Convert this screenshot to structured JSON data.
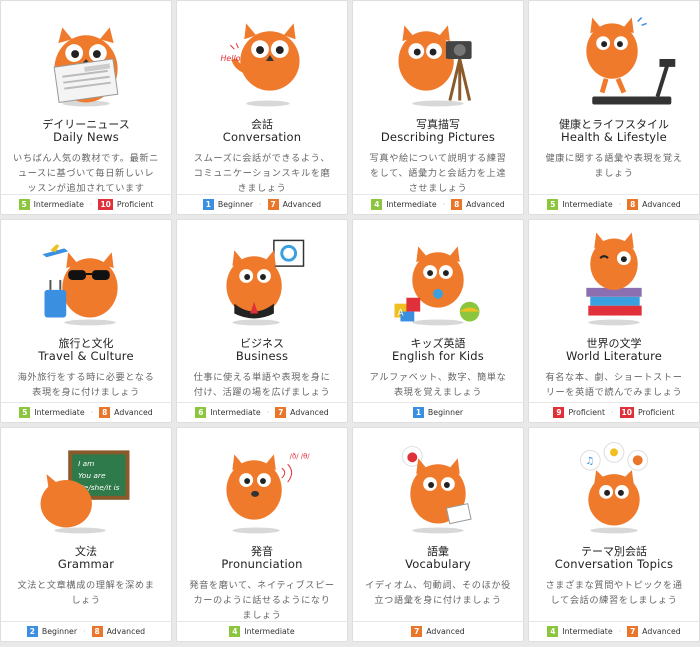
{
  "colors": {
    "orange": "#f07a2c",
    "beginner": "#3a8fe0",
    "intermediate": "#8cc63f",
    "advanced": "#e8762b",
    "proficient": "#e0313a"
  },
  "cards": [
    {
      "title_ja": "デイリーニュース",
      "title_en": "Daily News",
      "desc": "いちばん人気の教材です。最新ニュースに基づいて毎日新しいレッスンが追加されています",
      "icon": "owl-newspaper-icon",
      "levels": [
        {
          "num": "5",
          "label": "Intermediate",
          "color": "#8cc63f"
        },
        {
          "num": "10",
          "label": "Proficient",
          "color": "#e0313a"
        }
      ]
    },
    {
      "title_ja": "会話",
      "title_en": "Conversation",
      "desc": "スムーズに会話ができるよう、コミュニケーションスキルを磨きましょう",
      "icon": "owl-hello-icon",
      "levels": [
        {
          "num": "1",
          "label": "Beginner",
          "color": "#3a8fe0"
        },
        {
          "num": "7",
          "label": "Advanced",
          "color": "#e8762b"
        }
      ]
    },
    {
      "title_ja": "写真描写",
      "title_en": "Describing Pictures",
      "desc": "写真や絵について説明する練習をして、語彙力と会話力を上達させましょう",
      "icon": "owl-camera-icon",
      "levels": [
        {
          "num": "4",
          "label": "Intermediate",
          "color": "#8cc63f"
        },
        {
          "num": "8",
          "label": "Advanced",
          "color": "#e8762b"
        }
      ]
    },
    {
      "title_ja": "健康とライフスタイル",
      "title_en": "Health & Lifestyle",
      "desc": "健康に関する語彙や表現を覚えましょう",
      "icon": "owl-treadmill-icon",
      "levels": [
        {
          "num": "5",
          "label": "Intermediate",
          "color": "#8cc63f"
        },
        {
          "num": "8",
          "label": "Advanced",
          "color": "#e8762b"
        }
      ]
    },
    {
      "title_ja": "旅行と文化",
      "title_en": "Travel & Culture",
      "desc": "海外旅行をする時に必要となる表現を身に付けましょう",
      "icon": "owl-travel-icon",
      "levels": [
        {
          "num": "5",
          "label": "Intermediate",
          "color": "#8cc63f"
        },
        {
          "num": "8",
          "label": "Advanced",
          "color": "#e8762b"
        }
      ]
    },
    {
      "title_ja": "ビジネス",
      "title_en": "Business",
      "desc": "仕事に使える単語や表現を身に付け、活躍の場を広げましょう",
      "icon": "owl-business-icon",
      "levels": [
        {
          "num": "6",
          "label": "Intermediate",
          "color": "#8cc63f"
        },
        {
          "num": "7",
          "label": "Advanced",
          "color": "#e8762b"
        }
      ]
    },
    {
      "title_ja": "キッズ英語",
      "title_en": "English for Kids",
      "desc": "アルファベット、数字、簡単な表現を覚えましょう",
      "icon": "owl-kids-icon",
      "levels": [
        {
          "num": "1",
          "label": "Beginner",
          "color": "#3a8fe0"
        }
      ]
    },
    {
      "title_ja": "世界の文学",
      "title_en": "World Literature",
      "desc": "有名な本、劇、ショートストーリーを英語で読んでみましょう",
      "icon": "owl-books-icon",
      "levels": [
        {
          "num": "9",
          "label": "Proficient",
          "color": "#e0313a"
        },
        {
          "num": "10",
          "label": "Proficient",
          "color": "#e0313a"
        }
      ]
    },
    {
      "title_ja": "文法",
      "title_en": "Grammar",
      "desc": "文法と文章構成の理解を深めましょう",
      "icon": "owl-blackboard-icon",
      "board": [
        "I am",
        "You are",
        "He/she/it is"
      ],
      "levels": [
        {
          "num": "2",
          "label": "Beginner",
          "color": "#3a8fe0"
        },
        {
          "num": "8",
          "label": "Advanced",
          "color": "#e8762b"
        }
      ]
    },
    {
      "title_ja": "発音",
      "title_en": "Pronunciation",
      "desc": "発音を磨いて、ネイティブスピーカーのように話せるようになりましょう",
      "icon": "owl-pronunciation-icon",
      "levels": [
        {
          "num": "4",
          "label": "Intermediate",
          "color": "#8cc63f"
        }
      ]
    },
    {
      "title_ja": "語彙",
      "title_en": "Vocabulary",
      "desc": "イディオム、句動詞、そのほか役立つ語彙を身に付けましょう",
      "icon": "owl-apple-icon",
      "levels": [
        {
          "num": "7",
          "label": "Advanced",
          "color": "#e8762b"
        }
      ]
    },
    {
      "title_ja": "テーマ別会話",
      "title_en": "Conversation Topics",
      "desc": "さまざまな質問やトピックを通して会話の練習をしましょう",
      "icon": "owl-topics-icon",
      "levels": [
        {
          "num": "4",
          "label": "Intermediate",
          "color": "#8cc63f"
        },
        {
          "num": "7",
          "label": "Advanced",
          "color": "#e8762b"
        }
      ]
    }
  ]
}
